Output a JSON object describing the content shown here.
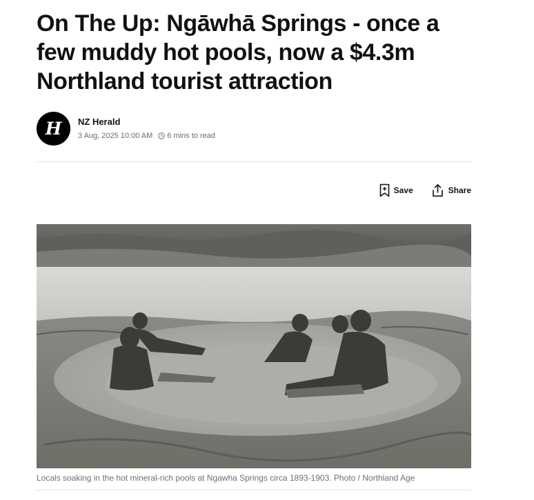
{
  "article": {
    "headline": "On The Up: Ngāwhā Springs - once a few muddy hot pools, now a $4.3m Northland tourist attraction",
    "author": {
      "name": "NZ Herald",
      "avatar_letter": "H",
      "avatar_icon": "nz-herald-logo-icon"
    },
    "date": "3 Aug, 2025 10:00 AM",
    "read_time": "6 mins to read",
    "actions": {
      "save_label": "Save",
      "save_icon": "bookmark-plus-icon",
      "share_label": "Share",
      "share_icon": "share-upload-icon"
    },
    "image": {
      "caption": "Locals soaking in the hot mineral-rich pools at Ngawha Springs circa 1893-1903. Photo / Northland Age"
    }
  }
}
